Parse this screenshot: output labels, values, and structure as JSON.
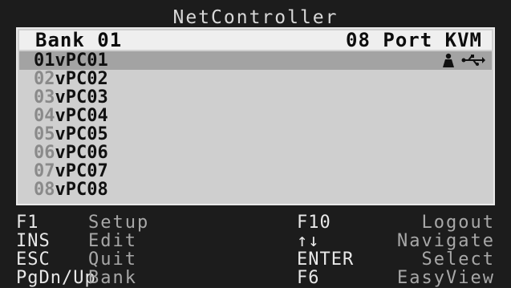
{
  "title": "NetController",
  "header": {
    "bank": "Bank 01",
    "model": "08 Port KVM"
  },
  "ports": [
    {
      "num": "01",
      "name": "vPC01",
      "selected": true
    },
    {
      "num": "02",
      "name": "vPC02",
      "selected": false
    },
    {
      "num": "03",
      "name": "vPC03",
      "selected": false
    },
    {
      "num": "04",
      "name": "vPC04",
      "selected": false
    },
    {
      "num": "05",
      "name": "vPC05",
      "selected": false
    },
    {
      "num": "06",
      "name": "vPC06",
      "selected": false
    },
    {
      "num": "07",
      "name": "vPC07",
      "selected": false
    },
    {
      "num": "08",
      "name": "vPC08",
      "selected": false
    }
  ],
  "row_icons": [
    "user-icon",
    "usb-icon"
  ],
  "help": [
    {
      "key": "F1",
      "desc": "Setup",
      "key2": "F10",
      "desc2": "Logout"
    },
    {
      "key": "INS",
      "desc": "Edit",
      "key2": "↑↓",
      "desc2": "Navigate"
    },
    {
      "key": "ESC",
      "desc": "Quit",
      "key2": "ENTER",
      "desc2": "Select"
    },
    {
      "key": "PgDn/Up",
      "desc": "Bank",
      "key2": "F6",
      "desc2": "EasyView"
    }
  ]
}
